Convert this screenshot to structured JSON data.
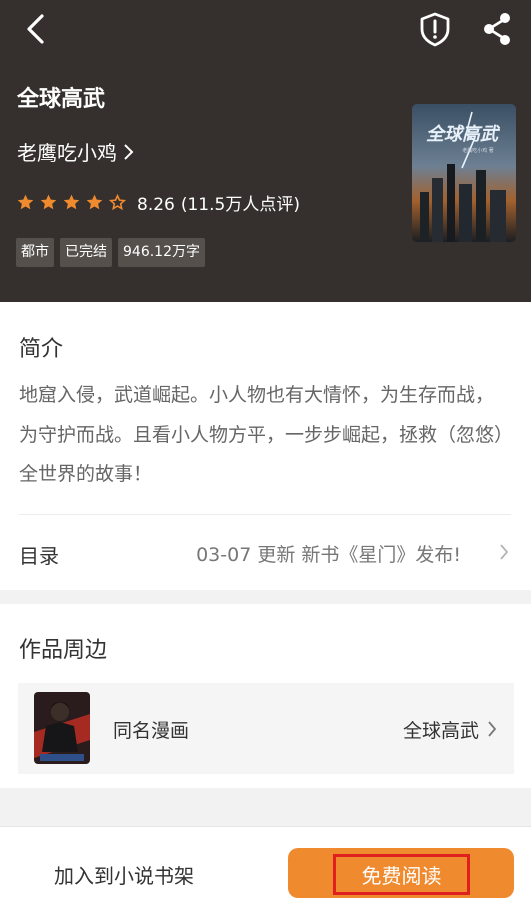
{
  "book": {
    "title": "全球高武",
    "author": "老鹰吃小鸡",
    "rating": "8.26",
    "review_count": "(11.5万人点评)",
    "stars_filled": 4,
    "stars_total": 5,
    "tags": [
      "都市",
      "已完结",
      "946.12万字"
    ],
    "cover_title": "全球高武",
    "cover_subtitle": "老鹰吃小鸡 著"
  },
  "intro": {
    "heading": "简介",
    "text": "地窟入侵，武道崛起。小人物也有大情怀，为生存而战，为守护而战。且看小人物方平，一步步崛起，拯救（忽悠）全世界的故事！"
  },
  "toc": {
    "label": "目录",
    "update": "03-07 更新 新书《星门》发布!"
  },
  "peripherals": {
    "heading": "作品周边",
    "comic_label": "同名漫画",
    "comic_name": "全球高武"
  },
  "bottom": {
    "add_shelf": "加入到小说书架",
    "read_label": "免费阅读"
  },
  "colors": {
    "header_bg": "#35302d",
    "star": "#f08a2e",
    "accent_button": "#ef8a2f",
    "highlight_box": "#e0201f"
  },
  "icons": [
    "back-arrow-icon",
    "shield-alert-icon",
    "share-icon",
    "star-icon",
    "chevron-right-icon"
  ]
}
